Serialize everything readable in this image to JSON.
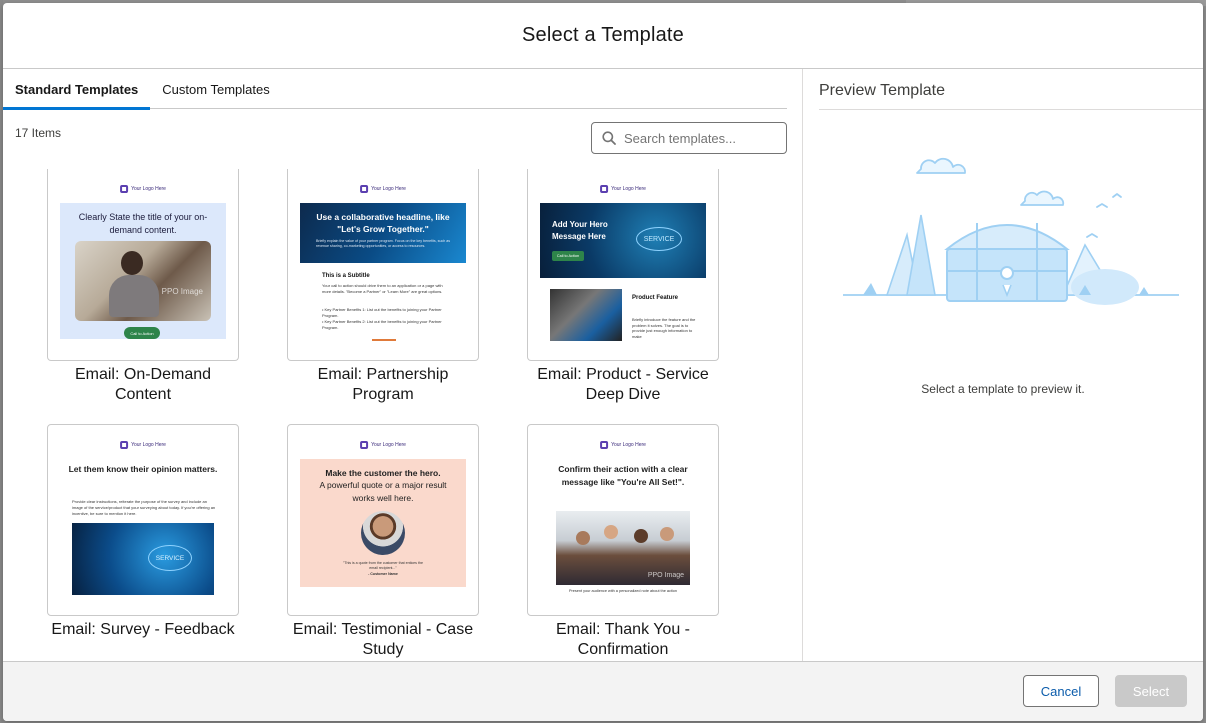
{
  "modal": {
    "title": "Select a Template"
  },
  "tabs": [
    {
      "label": "Standard Templates",
      "active": true
    },
    {
      "label": "Custom Templates",
      "active": false
    }
  ],
  "list": {
    "item_count": "17 Items",
    "search_placeholder": "Search templates..."
  },
  "templates": [
    {
      "label": "Email: On-Demand Content",
      "logo_text": "Your Logo Here",
      "heading": "Clearly State the title of your on-demand content.",
      "button": "Call to Action",
      "watermark": "PPO Image"
    },
    {
      "label": "Email: Partnership Program",
      "logo_text": "Your Logo Here",
      "heading": "Use a collaborative headline, like \"Let's Grow Together.\"",
      "body": "Briefly explain the value of your partner program. Focus on the key benefits, such as revenue sharing, co-marketing opportunities, or access to resources.",
      "subtitle": "This is a Subtitle",
      "text": "Your call to action should drive them to an application or a page with more details. \"Become a Partner\" or \"Learn More\" are great options.",
      "bullets": [
        "Key Partner Benefits 1: List out the benefits to joining your Partner Program.",
        "Key Partner Benefits 2: List out the benefits to joining your Partner Program."
      ]
    },
    {
      "label": "Email: Product - Service Deep Dive",
      "logo_text": "Your Logo Here",
      "heading": "Add Your Hero Message Here",
      "button": "Call to Action",
      "hero_word": "SERVICE",
      "feature_title": "Product Feature",
      "feature_text": "Briefly introduce the feature and the problem it solves. The goal is to provide just enough information to make"
    },
    {
      "label": "Email: Survey - Feedback",
      "logo_text": "Your Logo Here",
      "heading": "Let them know their opinion matters.",
      "body": "Provide clear instructions, reiterate the purpose of the survey and include an image of the service/product that your surveying about today. If you're offering an incentive, be sure to mention it here.",
      "hero_word": "SERVICE"
    },
    {
      "label": "Email: Testimonial - Case Study",
      "logo_text": "Your Logo Here",
      "heading": "Make the customer the hero.",
      "subheading": "A powerful quote or a major result works well here.",
      "quote": "\"This is a quote from the customer that entices the email recipient...\"",
      "author": "- Customer Name"
    },
    {
      "label": "Email: Thank You - Confirmation",
      "logo_text": "Your Logo Here",
      "heading": "Confirm their action with a clear message like \"You're All Set!\".",
      "footer": "Present your audience with a personalized note about the action",
      "watermark": "PPO Image"
    }
  ],
  "preview": {
    "title": "Preview Template",
    "message": "Select a template to preview it."
  },
  "footer": {
    "cancel_label": "Cancel",
    "select_label": "Select"
  },
  "colors": {
    "brand": "#0176d3",
    "cancel_text": "#0b5cab",
    "disabled": "#c9c9c9",
    "illustration": "#b6dcf7"
  }
}
